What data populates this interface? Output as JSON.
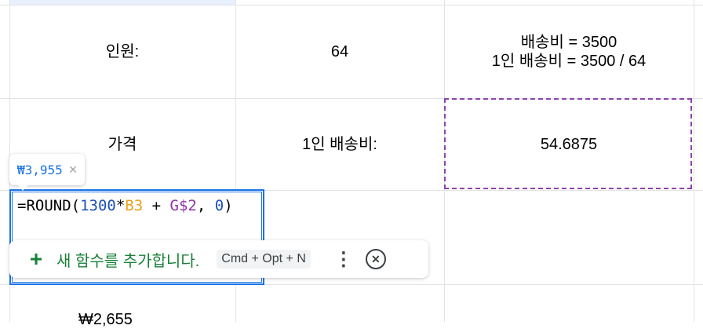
{
  "cells": {
    "label_people": "인원:",
    "value_people": "64",
    "note_line1": "배송비 = 3500",
    "note_line2": "1인 배송비 = 3500 / 64",
    "label_price": "가격",
    "label_per_shipping": "1인 배송비:",
    "value_per_shipping": "54.6875",
    "bottom_price": "₩2,655"
  },
  "editor": {
    "formula_start": "=ROUND(",
    "num1": "1300",
    "op1": "*",
    "ref1": "B3",
    "op2": " + ",
    "ref2": "G$2",
    "sep": ", ",
    "num2": "0",
    "end": ")"
  },
  "tooltip": {
    "value": "₩3,955",
    "close": "×"
  },
  "suggestion": {
    "icon": "plus-icon",
    "plus": "+",
    "label": "새 함수를 추가합니다.",
    "shortcut": "Cmd + Opt + N",
    "more": "⋮",
    "close": "✕"
  },
  "colors": {
    "accent": "#1a73e8",
    "green": "#188038",
    "purple": "#8e44ad",
    "number": "#1c4fb8",
    "ref1": "#e8a217",
    "ref2": "#9334a8"
  }
}
